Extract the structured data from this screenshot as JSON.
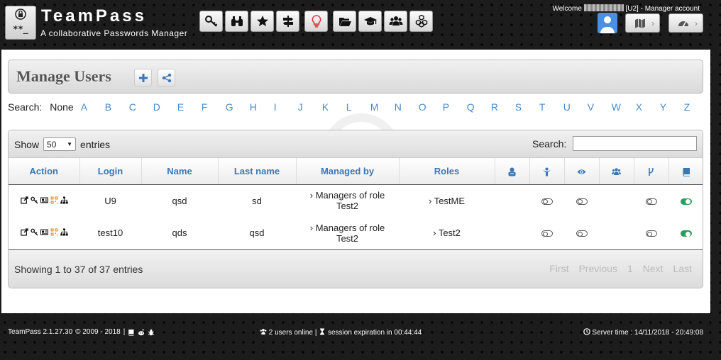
{
  "app": {
    "name": "TeamPass",
    "tagline": "A collaborative Passwords Manager",
    "logo_stars": "**_"
  },
  "header": {
    "welcome_prefix": "Welcome",
    "welcome_suffix": "[U2] - Manager account",
    "toolbar_icons": [
      "key-icon",
      "binoculars-icon",
      "star-icon",
      "signpost-icon",
      "lightbulb-icon",
      "folder-open-icon",
      "graduation-cap-icon",
      "users-icon",
      "cubes-icon"
    ],
    "right_buttons": [
      "map-icon",
      "dashboard-icon"
    ]
  },
  "page": {
    "title": "Manage Users"
  },
  "alphabet": {
    "label": "Search:",
    "none_label": "None",
    "letters": [
      "A",
      "B",
      "C",
      "D",
      "E",
      "F",
      "G",
      "H",
      "I",
      "J",
      "K",
      "L",
      "M",
      "N",
      "O",
      "P",
      "Q",
      "R",
      "S",
      "T",
      "U",
      "V",
      "W",
      "X",
      "Y",
      "Z"
    ]
  },
  "table": {
    "show_label": "Show",
    "page_size": "50",
    "entries_label": "entries",
    "search_label": "Search:",
    "search_value": "",
    "columns": [
      "Action",
      "Login",
      "Name",
      "Last name",
      "Managed by",
      "Roles"
    ],
    "icon_columns": [
      "admin-icon",
      "manager-icon",
      "read-only-icon",
      "can-manage-all-users-icon",
      "personal-folder-icon",
      "enabled-icon"
    ],
    "rows": [
      {
        "login": "U9",
        "name": "qsd",
        "last_name": "sd",
        "managed_by": "Managers of role Test2",
        "roles": "TestME",
        "toggles": [
          false,
          false,
          false,
          true
        ]
      },
      {
        "login": "test10",
        "name": "qds",
        "last_name": "qsd",
        "managed_by": "Managers of role Test2",
        "roles": "Test2",
        "toggles": [
          false,
          false,
          false,
          true
        ]
      }
    ],
    "info": "Showing 1 to 37 of 37 entries",
    "pager": {
      "first": "First",
      "previous": "Previous",
      "page": "1",
      "next": "Next",
      "last": "Last"
    }
  },
  "footer": {
    "version": "TeamPass 2.1.27.30",
    "copyright": "© 2009 - 2018",
    "users_online": "2 users online",
    "session": "session expiration in 00:44:44",
    "server_time": "Server time : 14/11/2018 - 20:49:08"
  },
  "colors": {
    "accent": "#3a76b6",
    "link": "#4a8ac8",
    "enabled": "#2e9e5e",
    "avatar": "#4a90e2"
  }
}
